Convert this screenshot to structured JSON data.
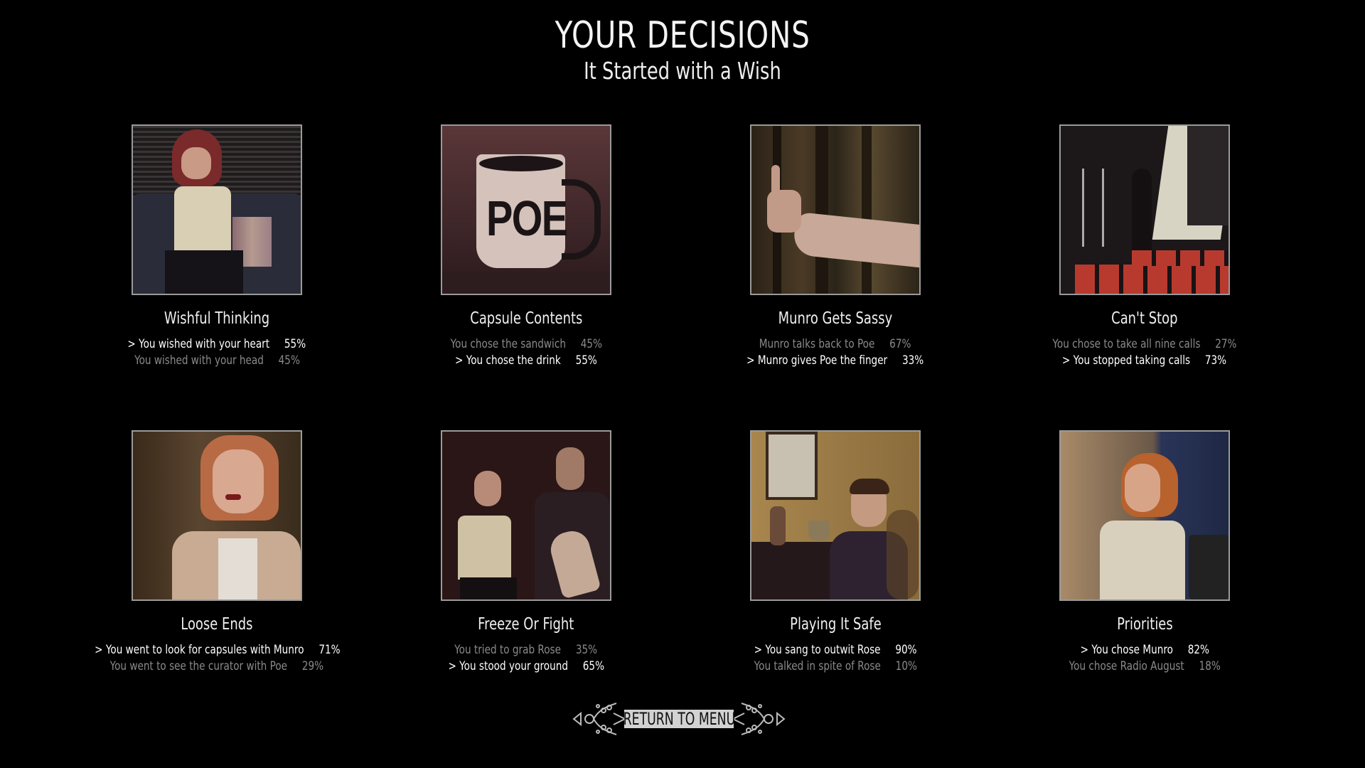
{
  "header": {
    "title": "YOUR DECISIONS",
    "subtitle": "It Started with a Wish"
  },
  "selected_marker": ">",
  "decisions": [
    {
      "title": "Wishful Thinking",
      "image": "woman-sitting-on-couch",
      "options": [
        {
          "text": "You wished with your heart",
          "percent": "55%",
          "selected": true
        },
        {
          "text": "You wished with your head",
          "percent": "45%",
          "selected": false
        }
      ]
    },
    {
      "title": "Capsule Contents",
      "image": "poe-mug",
      "options": [
        {
          "text": "You chose the sandwich",
          "percent": "45%",
          "selected": false
        },
        {
          "text": "You chose the drink",
          "percent": "55%",
          "selected": true
        }
      ]
    },
    {
      "title": "Munro Gets Sassy",
      "image": "hand-gesture-forest",
      "options": [
        {
          "text": "Munro talks back to Poe",
          "percent": "67%",
          "selected": false
        },
        {
          "text": "Munro gives Poe the finger",
          "percent": "33%",
          "selected": true
        }
      ]
    },
    {
      "title": "Can't Stop",
      "image": "radio-mixing-board",
      "options": [
        {
          "text": "You chose to take all nine calls",
          "percent": "27%",
          "selected": false
        },
        {
          "text": "You stopped taking calls",
          "percent": "73%",
          "selected": true
        }
      ]
    },
    {
      "title": "Loose Ends",
      "image": "woman-in-trench-coat-forest",
      "options": [
        {
          "text": "You went to look for capsules with Munro",
          "percent": "71%",
          "selected": true
        },
        {
          "text": "You went to see the curator with Poe",
          "percent": "29%",
          "selected": false
        }
      ]
    },
    {
      "title": "Freeze Or Fight",
      "image": "couple-with-raised-hand",
      "options": [
        {
          "text": "You tried to grab Rose",
          "percent": "35%",
          "selected": false
        },
        {
          "text": "You stood your ground",
          "percent": "65%",
          "selected": true
        }
      ]
    },
    {
      "title": "Playing It Safe",
      "image": "man-at-piano",
      "options": [
        {
          "text": "You sang to outwit Rose",
          "percent": "90%",
          "selected": true
        },
        {
          "text": "You talked in spite of Rose",
          "percent": "10%",
          "selected": false
        }
      ]
    },
    {
      "title": "Priorities",
      "image": "woman-looking-over-shoulder",
      "options": [
        {
          "text": "You chose Munro",
          "percent": "82%",
          "selected": true
        },
        {
          "text": "You chose Radio August",
          "percent": "18%",
          "selected": false
        }
      ]
    }
  ],
  "footer": {
    "return_label": "RETURN TO MENU"
  },
  "colors": {
    "background": "#000000",
    "selected_text": "#ffffff",
    "unselected_text": "#8a8a8a",
    "thumb_border": "#9a9a9a",
    "button_banner": "#d2d2d2"
  }
}
